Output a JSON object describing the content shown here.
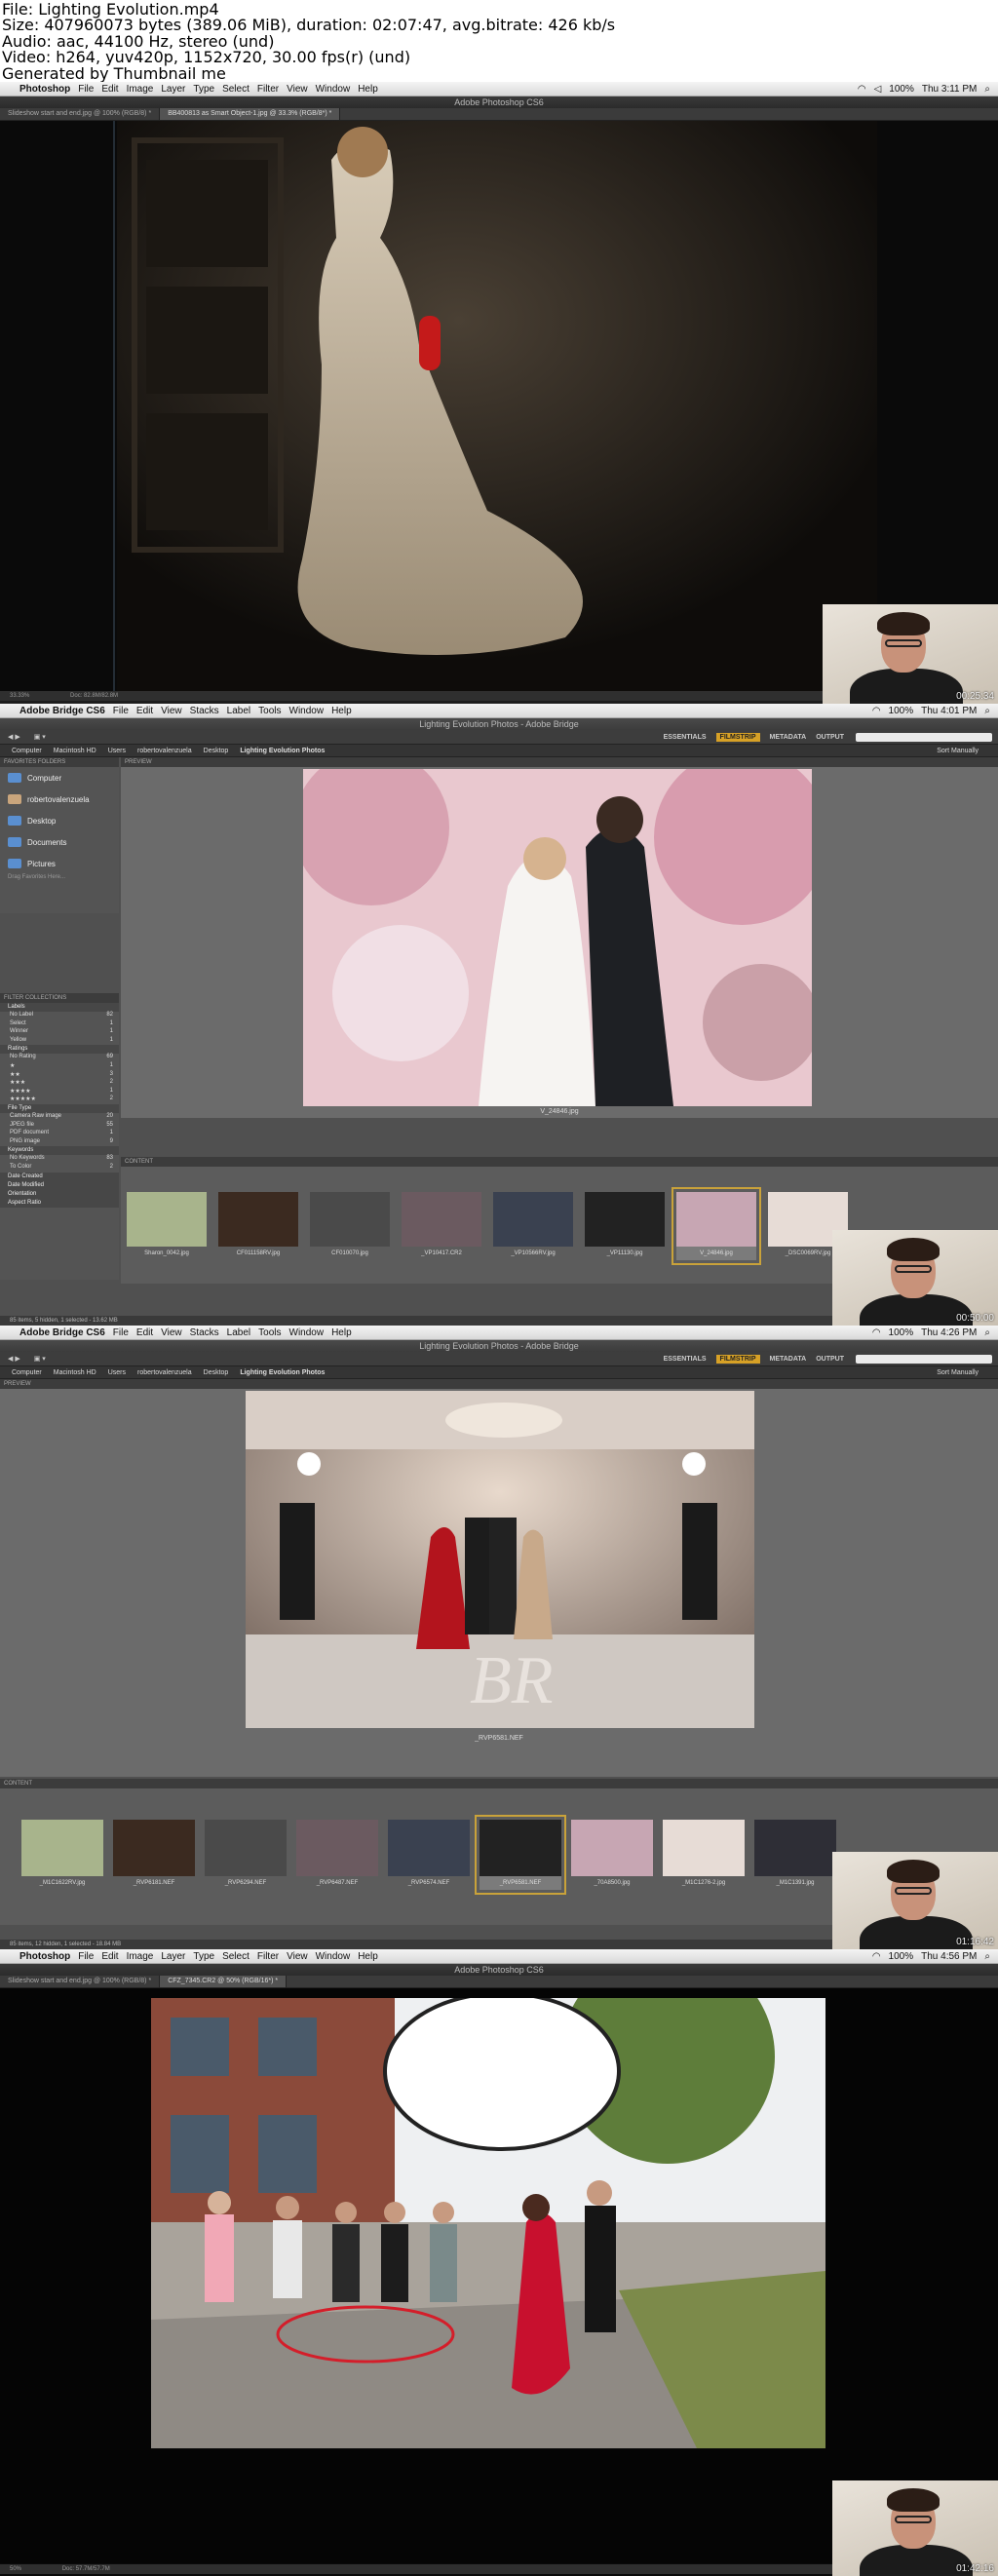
{
  "header": {
    "lines": [
      "File: Lighting Evolution.mp4",
      "Size: 407960073 bytes (389.06 MiB), duration: 02:07:47, avg.bitrate: 426 kb/s",
      "Audio: aac, 44100 Hz, stereo (und)",
      "Video: h264, yuv420p, 1152x720, 30.00 fps(r) (und)",
      "Generated by Thumbnail me"
    ]
  },
  "frame1": {
    "menubar": {
      "app": "Photoshop",
      "items": [
        "File",
        "Edit",
        "Image",
        "Layer",
        "Type",
        "Select",
        "Filter",
        "View",
        "Window",
        "Help"
      ],
      "battery": "100%",
      "clock": "Thu 3:11 PM"
    },
    "window_title": "Adobe Photoshop CS6",
    "tabs": [
      "Slideshow start and end.jpg @ 100% (RGB/8) *",
      "BB400813 as Smart Object-1.jpg @ 33.3% (RGB/8*) *"
    ],
    "status": {
      "zoom": "33.33%",
      "doc": "Doc: 82.8M/82.8M"
    },
    "timestamp": "00:25:34"
  },
  "frame2": {
    "menubar": {
      "app": "Adobe Bridge CS6",
      "items": [
        "File",
        "Edit",
        "View",
        "Stacks",
        "Label",
        "Tools",
        "Window",
        "Help"
      ],
      "battery": "100%",
      "clock": "Thu 4:01 PM"
    },
    "window_title": "Lighting Evolution Photos - Adobe Bridge",
    "workspaces": [
      "ESSENTIALS",
      "FILMSTRIP",
      "METADATA",
      "OUTPUT"
    ],
    "active_workspace": "FILMSTRIP",
    "path": [
      "Computer",
      "Macintosh HD",
      "Users",
      "robertovalenzuela",
      "Desktop",
      "Lighting Evolution Photos"
    ],
    "sort": "Sort Manually",
    "left_tabs": "FAVORITES  FOLDERS",
    "favorites": [
      "Computer",
      "robertovalenzuela",
      "Desktop",
      "Documents",
      "Pictures"
    ],
    "drag_hint": "Drag Favorites Here...",
    "filter_tabs": "FILTER  COLLECTIONS",
    "filters": [
      {
        "head": "Labels"
      },
      {
        "label": "No Label",
        "count": "82"
      },
      {
        "label": "Select",
        "count": "1"
      },
      {
        "label": "Winner",
        "count": "1"
      },
      {
        "label": "Yellow",
        "count": "1"
      },
      {
        "head": "Ratings"
      },
      {
        "label": "No Rating",
        "count": "69"
      },
      {
        "label": "★",
        "count": "1"
      },
      {
        "label": "★★",
        "count": "3"
      },
      {
        "label": "★★★",
        "count": "2"
      },
      {
        "label": "★★★★",
        "count": "1"
      },
      {
        "label": "★★★★★",
        "count": "2"
      },
      {
        "head": "File Type"
      },
      {
        "label": "Camera Raw image",
        "count": "20"
      },
      {
        "label": "JPEG file",
        "count": "55"
      },
      {
        "label": "PDF document",
        "count": "1"
      },
      {
        "label": "PNG image",
        "count": "9"
      },
      {
        "head": "Keywords"
      },
      {
        "label": "No Keywords",
        "count": "83"
      },
      {
        "label": "To Color",
        "count": "2"
      },
      {
        "head": "Date Created"
      },
      {
        "head": "Date Modified"
      },
      {
        "head": "Orientation"
      },
      {
        "head": "Aspect Ratio"
      }
    ],
    "preview_label": "PREVIEW",
    "preview_filename": "V_24846.jpg",
    "content_label": "CONTENT",
    "thumbs": [
      "Sharon_0042.jpg",
      "CF011158RV.jpg",
      "CF010070.jpg",
      "_VP10417.CR2",
      "_VP10566RV.jpg",
      "_VP11130.jpg",
      "V_24846.jpg",
      "_DSC0069RV.jpg"
    ],
    "selected_thumb": 6,
    "status": "85 items, 5 hidden, 1 selected - 13.62 MB",
    "timestamp": "00:50:00"
  },
  "frame3": {
    "menubar": {
      "app": "Adobe Bridge CS6",
      "items": [
        "File",
        "Edit",
        "View",
        "Stacks",
        "Label",
        "Tools",
        "Window",
        "Help"
      ],
      "battery": "100%",
      "clock": "Thu 4:26 PM"
    },
    "window_title": "Lighting Evolution Photos - Adobe Bridge",
    "workspaces": [
      "ESSENTIALS",
      "FILMSTRIP",
      "METADATA",
      "OUTPUT"
    ],
    "active_workspace": "FILMSTRIP",
    "path": [
      "Computer",
      "Macintosh HD",
      "Users",
      "robertovalenzuela",
      "Desktop",
      "Lighting Evolution Photos"
    ],
    "sort": "Sort Manually",
    "preview_label": "PREVIEW",
    "preview_filename": "_RVP6581.NEF",
    "content_label": "CONTENT",
    "thumbs": [
      "_M1C1622RV.jpg",
      "_RVP6181.NEF",
      "_RVP6294.NEF",
      "_RVP6487.NEF",
      "_RVP6574.NEF",
      "_RVP6581.NEF",
      "_70A8500.jpg",
      "_M1C1276-2.jpg",
      "_M1C1391.jpg"
    ],
    "selected_thumb": 5,
    "status": "85 items, 12 hidden, 1 selected - 18.84 MB",
    "timestamp": "01:16:42"
  },
  "frame4": {
    "menubar": {
      "app": "Photoshop",
      "items": [
        "File",
        "Edit",
        "Image",
        "Layer",
        "Type",
        "Select",
        "Filter",
        "View",
        "Window",
        "Help"
      ],
      "battery": "100%",
      "clock": "Thu 4:56 PM"
    },
    "window_title": "Adobe Photoshop CS6",
    "tabs": [
      "Slideshow start and end.jpg @ 100% (RGB/8) *",
      "CFZ_7345.CR2 @ 50% (RGB/16*) *"
    ],
    "status": {
      "zoom": "50%",
      "doc": "Doc: 57.7M/57.7M"
    },
    "timestamp": "01:42:16"
  }
}
